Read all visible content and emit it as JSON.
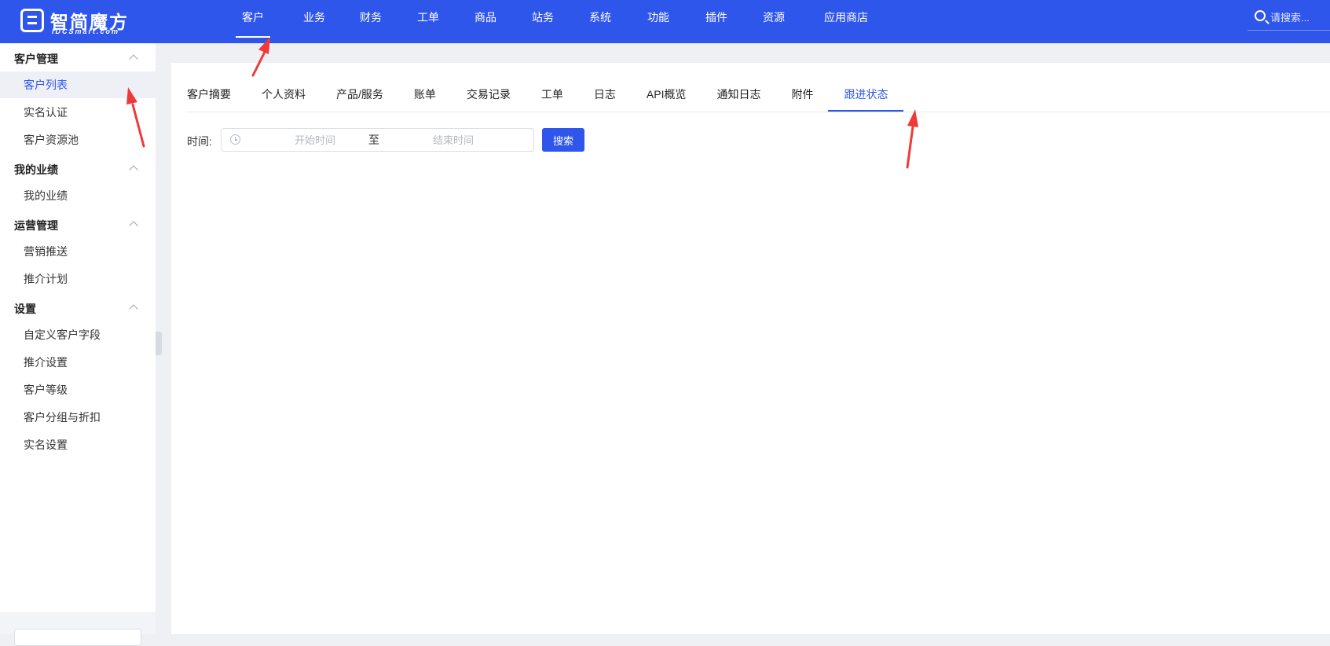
{
  "header": {
    "logo_cn": "智简魔方",
    "logo_en": "IDCSmart.com",
    "nav": [
      {
        "label": "客户",
        "active": true
      },
      {
        "label": "业务"
      },
      {
        "label": "财务"
      },
      {
        "label": "工单"
      },
      {
        "label": "商品"
      },
      {
        "label": "站务"
      },
      {
        "label": "系统"
      },
      {
        "label": "功能"
      },
      {
        "label": "插件"
      },
      {
        "label": "资源"
      },
      {
        "label": "应用商店"
      }
    ],
    "search_placeholder": "请搜索..."
  },
  "sidebar": {
    "groups": [
      {
        "title": "客户管理",
        "items": [
          {
            "label": "客户列表",
            "active": true
          },
          {
            "label": "实名认证"
          },
          {
            "label": "客户资源池"
          }
        ]
      },
      {
        "title": "我的业绩",
        "items": [
          {
            "label": "我的业绩"
          }
        ]
      },
      {
        "title": "运营管理",
        "items": [
          {
            "label": "营销推送"
          },
          {
            "label": "推介计划"
          }
        ]
      },
      {
        "title": "设置",
        "items": [
          {
            "label": "自定义客户字段"
          },
          {
            "label": "推介设置"
          },
          {
            "label": "客户等级"
          },
          {
            "label": "客户分组与折扣"
          },
          {
            "label": "实名设置"
          }
        ]
      }
    ]
  },
  "tabs": [
    {
      "label": "客户摘要"
    },
    {
      "label": "个人资料"
    },
    {
      "label": "产品/服务"
    },
    {
      "label": "账单"
    },
    {
      "label": "交易记录"
    },
    {
      "label": "工单"
    },
    {
      "label": "日志"
    },
    {
      "label": "API概览"
    },
    {
      "label": "通知日志"
    },
    {
      "label": "附件"
    },
    {
      "label": "跟进状态",
      "active": true
    }
  ],
  "filter": {
    "time_label": "时间:",
    "start_placeholder": "开始时间",
    "separator": "至",
    "end_placeholder": "结束时间",
    "search_button": "搜索"
  },
  "colors": {
    "primary": "#2f56eb",
    "annotation_arrow": "#f03a3a"
  }
}
